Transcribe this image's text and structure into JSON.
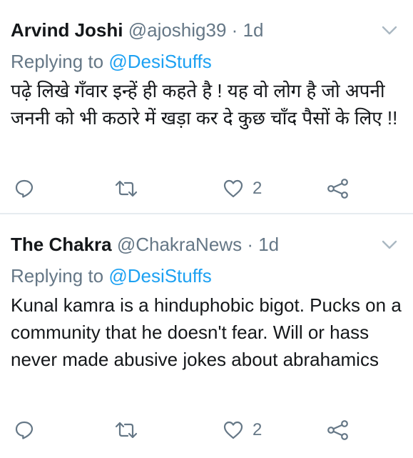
{
  "tweets": [
    {
      "name": "Arvind Joshi",
      "handle": "@ajoshig39",
      "separator": "·",
      "time": "1d",
      "replying_prefix": "Replying to",
      "replying_to": "@DesiStuffs",
      "text": "पढ़े लिखे गँवार इन्हें ही कहते है ! यह वो लोग है जो अपनी जननी को भी कठारे में खड़ा कर दे कुछ चाँद पैसों के लिए !!",
      "like_count": "2"
    },
    {
      "name": "The Chakra",
      "handle": "@ChakraNews",
      "separator": "·",
      "time": "1d",
      "replying_prefix": "Replying to",
      "replying_to": "@DesiStuffs",
      "text": "Kunal kamra is a hinduphobic bigot. Pucks on a community that he doesn't fear. Will or hass never made abusive jokes about abrahamics",
      "like_count": "2"
    }
  ],
  "icons": {
    "reply": "reply-icon",
    "retweet": "retweet-icon",
    "like": "heart-icon",
    "share": "share-icon",
    "menu": "chevron-down-icon"
  },
  "colors": {
    "text": "#14171a",
    "muted": "#657786",
    "link": "#1da1f2",
    "divider": "#e6ecf0"
  }
}
